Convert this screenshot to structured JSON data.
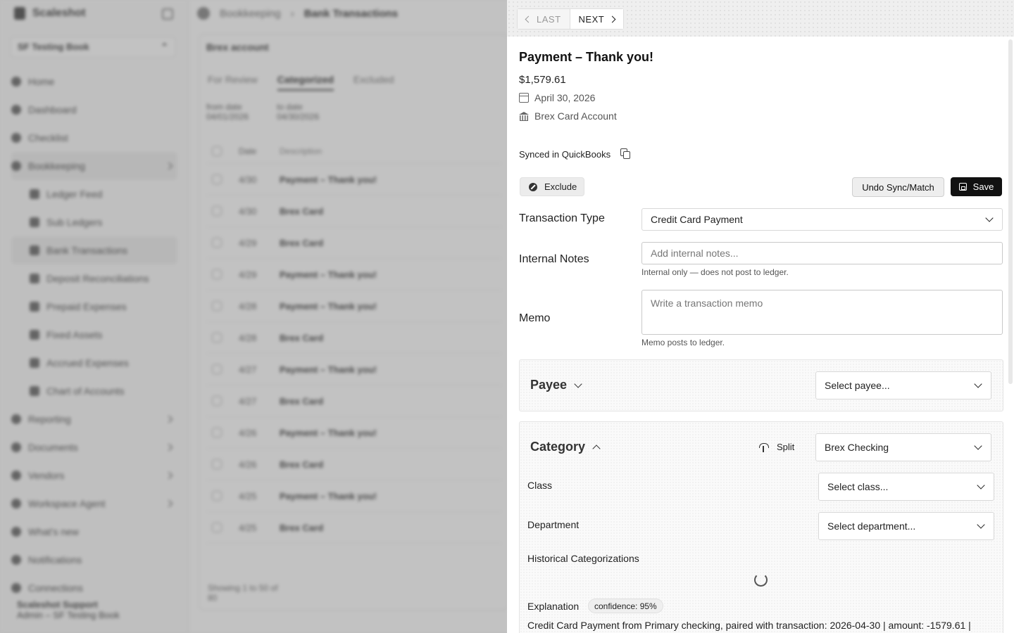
{
  "background": {
    "brand": "Scaleshot",
    "workspace": "SF Testing Book",
    "nav": [
      "Home",
      "Dashboard",
      "Checklist",
      "Bookkeeping"
    ],
    "bookkeeping_sub": [
      "Ledger Feed",
      "Sub Ledgers",
      "Bank Transactions",
      "Deposit Reconciliations",
      "Prepaid Expenses",
      "Fixed Assets",
      "Accrued Expenses",
      "Chart of Accounts"
    ],
    "nav_lower": [
      "Reporting",
      "Documents",
      "Vendors",
      "Workspace Agent",
      "What's new",
      "Notifications",
      "Connections"
    ],
    "user_name": "Scaleshot Support",
    "user_org": "Admin – SF Testing Book",
    "crumbs": [
      "Bookkeeping",
      "Bank Transactions"
    ],
    "card_title": "Brex account",
    "tabs": [
      "For Review",
      "Categorized",
      "Excluded"
    ],
    "from_label": "from date",
    "from_value": "04/01/2026",
    "to_label": "to date",
    "to_value": "04/30/2026",
    "col_date": "Date",
    "col_desc": "Description",
    "rows": [
      {
        "date": "4/30",
        "desc": "Payment – Thank you!"
      },
      {
        "date": "4/30",
        "desc": "Brex Card"
      },
      {
        "date": "4/29",
        "desc": "Brex Card"
      },
      {
        "date": "4/29",
        "desc": "Payment – Thank you!"
      },
      {
        "date": "4/28",
        "desc": "Payment – Thank you!"
      },
      {
        "date": "4/28",
        "desc": "Brex Card"
      },
      {
        "date": "4/27",
        "desc": "Payment – Thank you!"
      },
      {
        "date": "4/27",
        "desc": "Brex Card"
      },
      {
        "date": "4/26",
        "desc": "Payment – Thank you!"
      },
      {
        "date": "4/26",
        "desc": "Brex Card"
      },
      {
        "date": "4/25",
        "desc": "Payment – Thank you!"
      },
      {
        "date": "4/25",
        "desc": "Brex Card"
      }
    ],
    "footer": "Showing 1 to 50 of",
    "footer2": "80"
  },
  "drawer": {
    "nav": {
      "last_label": "LAST",
      "next_label": "NEXT"
    },
    "title": "Payment – Thank you!",
    "amount": "$1,579.61",
    "date": "April 30, 2026",
    "account": "Brex Card Account",
    "synced_label": "Synced in QuickBooks",
    "exclude_label": "Exclude",
    "undo_label": "Undo Sync/Match",
    "save_label": "Save",
    "transaction_type": {
      "label": "Transaction Type",
      "value": "Credit Card Payment"
    },
    "internal_notes": {
      "label": "Internal Notes",
      "placeholder": "Add internal notes...",
      "help": "Internal only — does not post to ledger."
    },
    "memo": {
      "label": "Memo",
      "placeholder": "Write a transaction memo",
      "help": "Memo posts to ledger."
    },
    "payee": {
      "label": "Payee",
      "placeholder": "Select payee..."
    },
    "category": {
      "label": "Category",
      "split_label": "Split",
      "value": "Brex Checking",
      "class_label": "Class",
      "class_placeholder": "Select class...",
      "department_label": "Department",
      "department_placeholder": "Select department...",
      "historical_label": "Historical Categorizations",
      "explanation_label": "Explanation",
      "confidence": "confidence: 95%",
      "explanation_text": "Credit Card Payment from Primary checking, paired with transaction: 2026-04-30 | amount: -1579.61 |"
    }
  }
}
